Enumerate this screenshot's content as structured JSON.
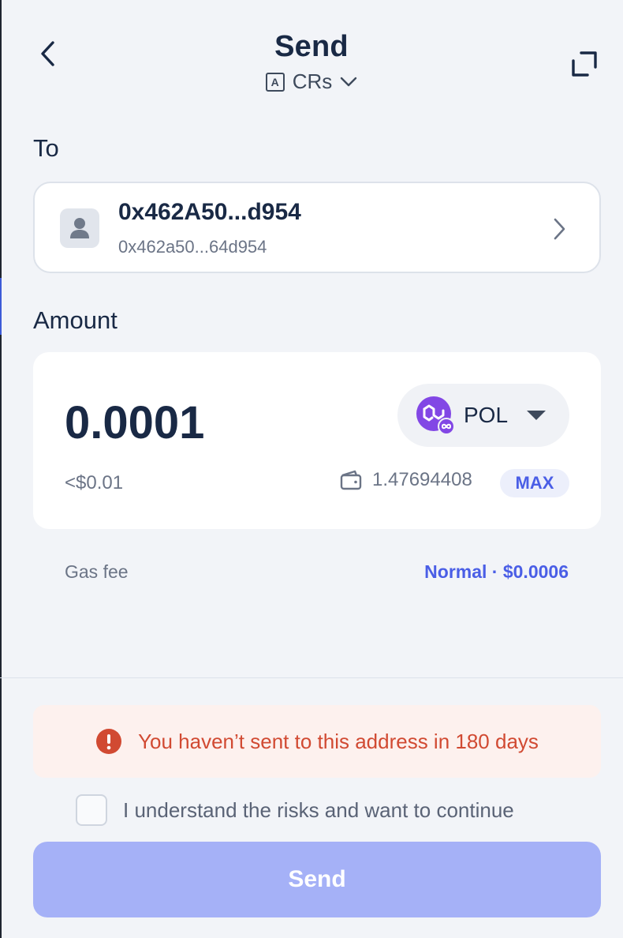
{
  "header": {
    "title": "Send",
    "account_badge": "A",
    "account_name": "CRs"
  },
  "recipient": {
    "label": "To",
    "name": "0x462A50...d954",
    "address": "0x462a50...64d954"
  },
  "amount": {
    "label": "Amount",
    "value": "0.0001",
    "fiat": "<$0.01",
    "token_symbol": "POL",
    "balance": "1.47694408",
    "max_label": "MAX"
  },
  "gas": {
    "label": "Gas fee",
    "value": "Normal · $0.0006"
  },
  "warning": {
    "text": "You haven’t sent to this address in 180 days"
  },
  "risk": {
    "label": "I understand the risks and want to continue",
    "checked": false
  },
  "send_button": {
    "label": "Send"
  },
  "colors": {
    "accent": "#4a5ee6",
    "send_button_disabled": "#a5b1f7",
    "warning": "#d14a32",
    "warning_bg": "#fdf1ee",
    "token_brand": "#8247e5"
  }
}
